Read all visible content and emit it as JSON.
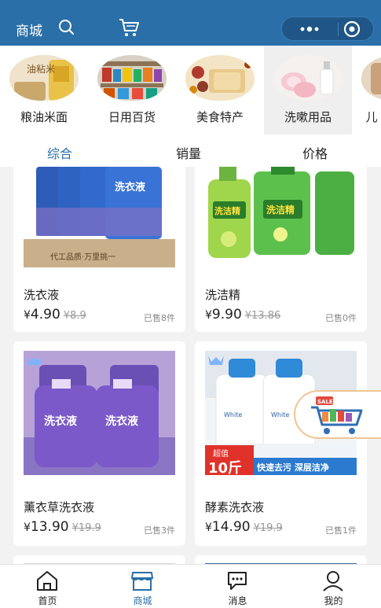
{
  "header": {
    "title": "商城"
  },
  "categories": [
    {
      "label": "粮油米面",
      "image_text": "油粘米"
    },
    {
      "label": "日用百货"
    },
    {
      "label": "美食特产"
    },
    {
      "label": "洗嗽用品"
    },
    {
      "label": "儿"
    }
  ],
  "sort_tabs": [
    "综合",
    "销量",
    "价格"
  ],
  "products": [
    {
      "name": "洗衣液",
      "currency": "¥",
      "price": "4.90",
      "orig": "¥8.9",
      "sold": "已售8件",
      "pack_text": "洗衣液",
      "banner_text": "代工品质·万里挑一"
    },
    {
      "name": "洗洁精",
      "currency": "¥",
      "price": "9.90",
      "orig": "¥13.86",
      "sold": "已售0件",
      "pack_text": "洗洁精"
    },
    {
      "name": "薰衣草洗衣液",
      "currency": "¥",
      "price": "13.90",
      "orig": "¥19.9",
      "sold": "已售3件",
      "pack_text": "洗衣液"
    },
    {
      "name": "酵素洗衣液",
      "currency": "¥",
      "price": "14.90",
      "orig": "¥19.9",
      "sold": "已售1件",
      "promo_small": "超值",
      "promo_big": "10斤",
      "promo_line": "快速去污 深层洁净",
      "bottle_text": "White"
    }
  ],
  "sale_badge": "SALE",
  "tabbar": [
    {
      "label": "首页",
      "icon": "home-icon"
    },
    {
      "label": "商城",
      "icon": "store-icon"
    },
    {
      "label": "消息",
      "icon": "message-icon"
    },
    {
      "label": "我的",
      "icon": "user-icon"
    }
  ],
  "colors": {
    "primary": "#2a6fa8",
    "capsule": "#1f5687"
  }
}
